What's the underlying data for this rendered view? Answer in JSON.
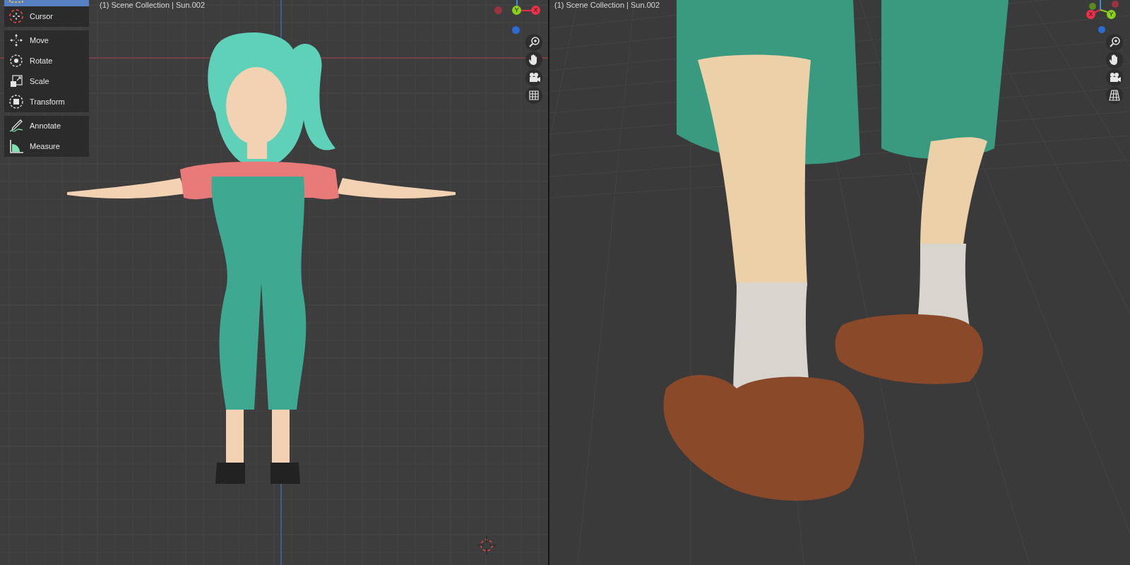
{
  "viewports": [
    {
      "kind": "front",
      "header": "(1) Scene Collection | Sun.002",
      "toolbar": [
        [
          {
            "kind": "select_box",
            "selected": true
          },
          {
            "kind": "cursor",
            "label": "Cursor",
            "selected": false
          }
        ],
        [
          {
            "kind": "move",
            "label": "Move",
            "selected": false
          },
          {
            "kind": "rotate",
            "label": "Rotate",
            "selected": false
          },
          {
            "kind": "scale",
            "label": "Scale",
            "selected": false
          },
          {
            "kind": "transform",
            "label": "Transform",
            "selected": false
          }
        ],
        [
          {
            "kind": "annotate",
            "label": "Annotate",
            "selected": false
          },
          {
            "kind": "measure",
            "label": "Measure",
            "selected": false
          }
        ]
      ],
      "gizmo": {
        "y_label": "Y",
        "x_label": "X"
      }
    },
    {
      "kind": "perspective",
      "header": "(1) Scene Collection | Sun.002",
      "gizmo": {
        "y_label": "Y",
        "x_label": "X"
      }
    }
  ]
}
